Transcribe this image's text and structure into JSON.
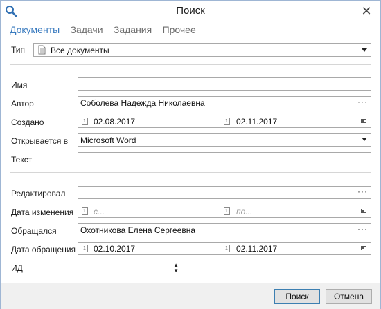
{
  "window": {
    "title": "Поиск",
    "close_glyph": "✕"
  },
  "tabs": [
    {
      "label": "Документы",
      "active": true
    },
    {
      "label": "Задачи"
    },
    {
      "label": "Задания"
    },
    {
      "label": "Прочее"
    }
  ],
  "type": {
    "label": "Тип",
    "value": "Все документы"
  },
  "fields": {
    "name": {
      "label": "Имя",
      "value": ""
    },
    "author": {
      "label": "Автор",
      "value": "Соболева Надежда Николаевна"
    },
    "created": {
      "label": "Создано",
      "from": "02.08.2017",
      "to": "02.11.2017"
    },
    "opens_in": {
      "label": "Открывается в",
      "value": "Microsoft Word"
    },
    "text": {
      "label": "Текст",
      "value": ""
    },
    "edited_by": {
      "label": "Редактировал",
      "value": ""
    },
    "modified": {
      "label": "Дата изменения",
      "from_placeholder": "с...",
      "to_placeholder": "по..."
    },
    "accessed_by": {
      "label": "Обращался",
      "value": "Охотникова Елена Сергеевна"
    },
    "accessed": {
      "label": "Дата обращения",
      "from": "02.10.2017",
      "to": "02.11.2017"
    },
    "id": {
      "label": "ИД",
      "value": ""
    }
  },
  "buttons": {
    "search": "Поиск",
    "cancel": "Отмена"
  },
  "icons": {
    "ellipsis": "···",
    "calendar_day": "1",
    "spin_up": "▲",
    "spin_down": "▼"
  },
  "colors": {
    "accent": "#3a7bbf",
    "tab_inactive": "#6d6d6d",
    "border": "#a9a9a9"
  }
}
